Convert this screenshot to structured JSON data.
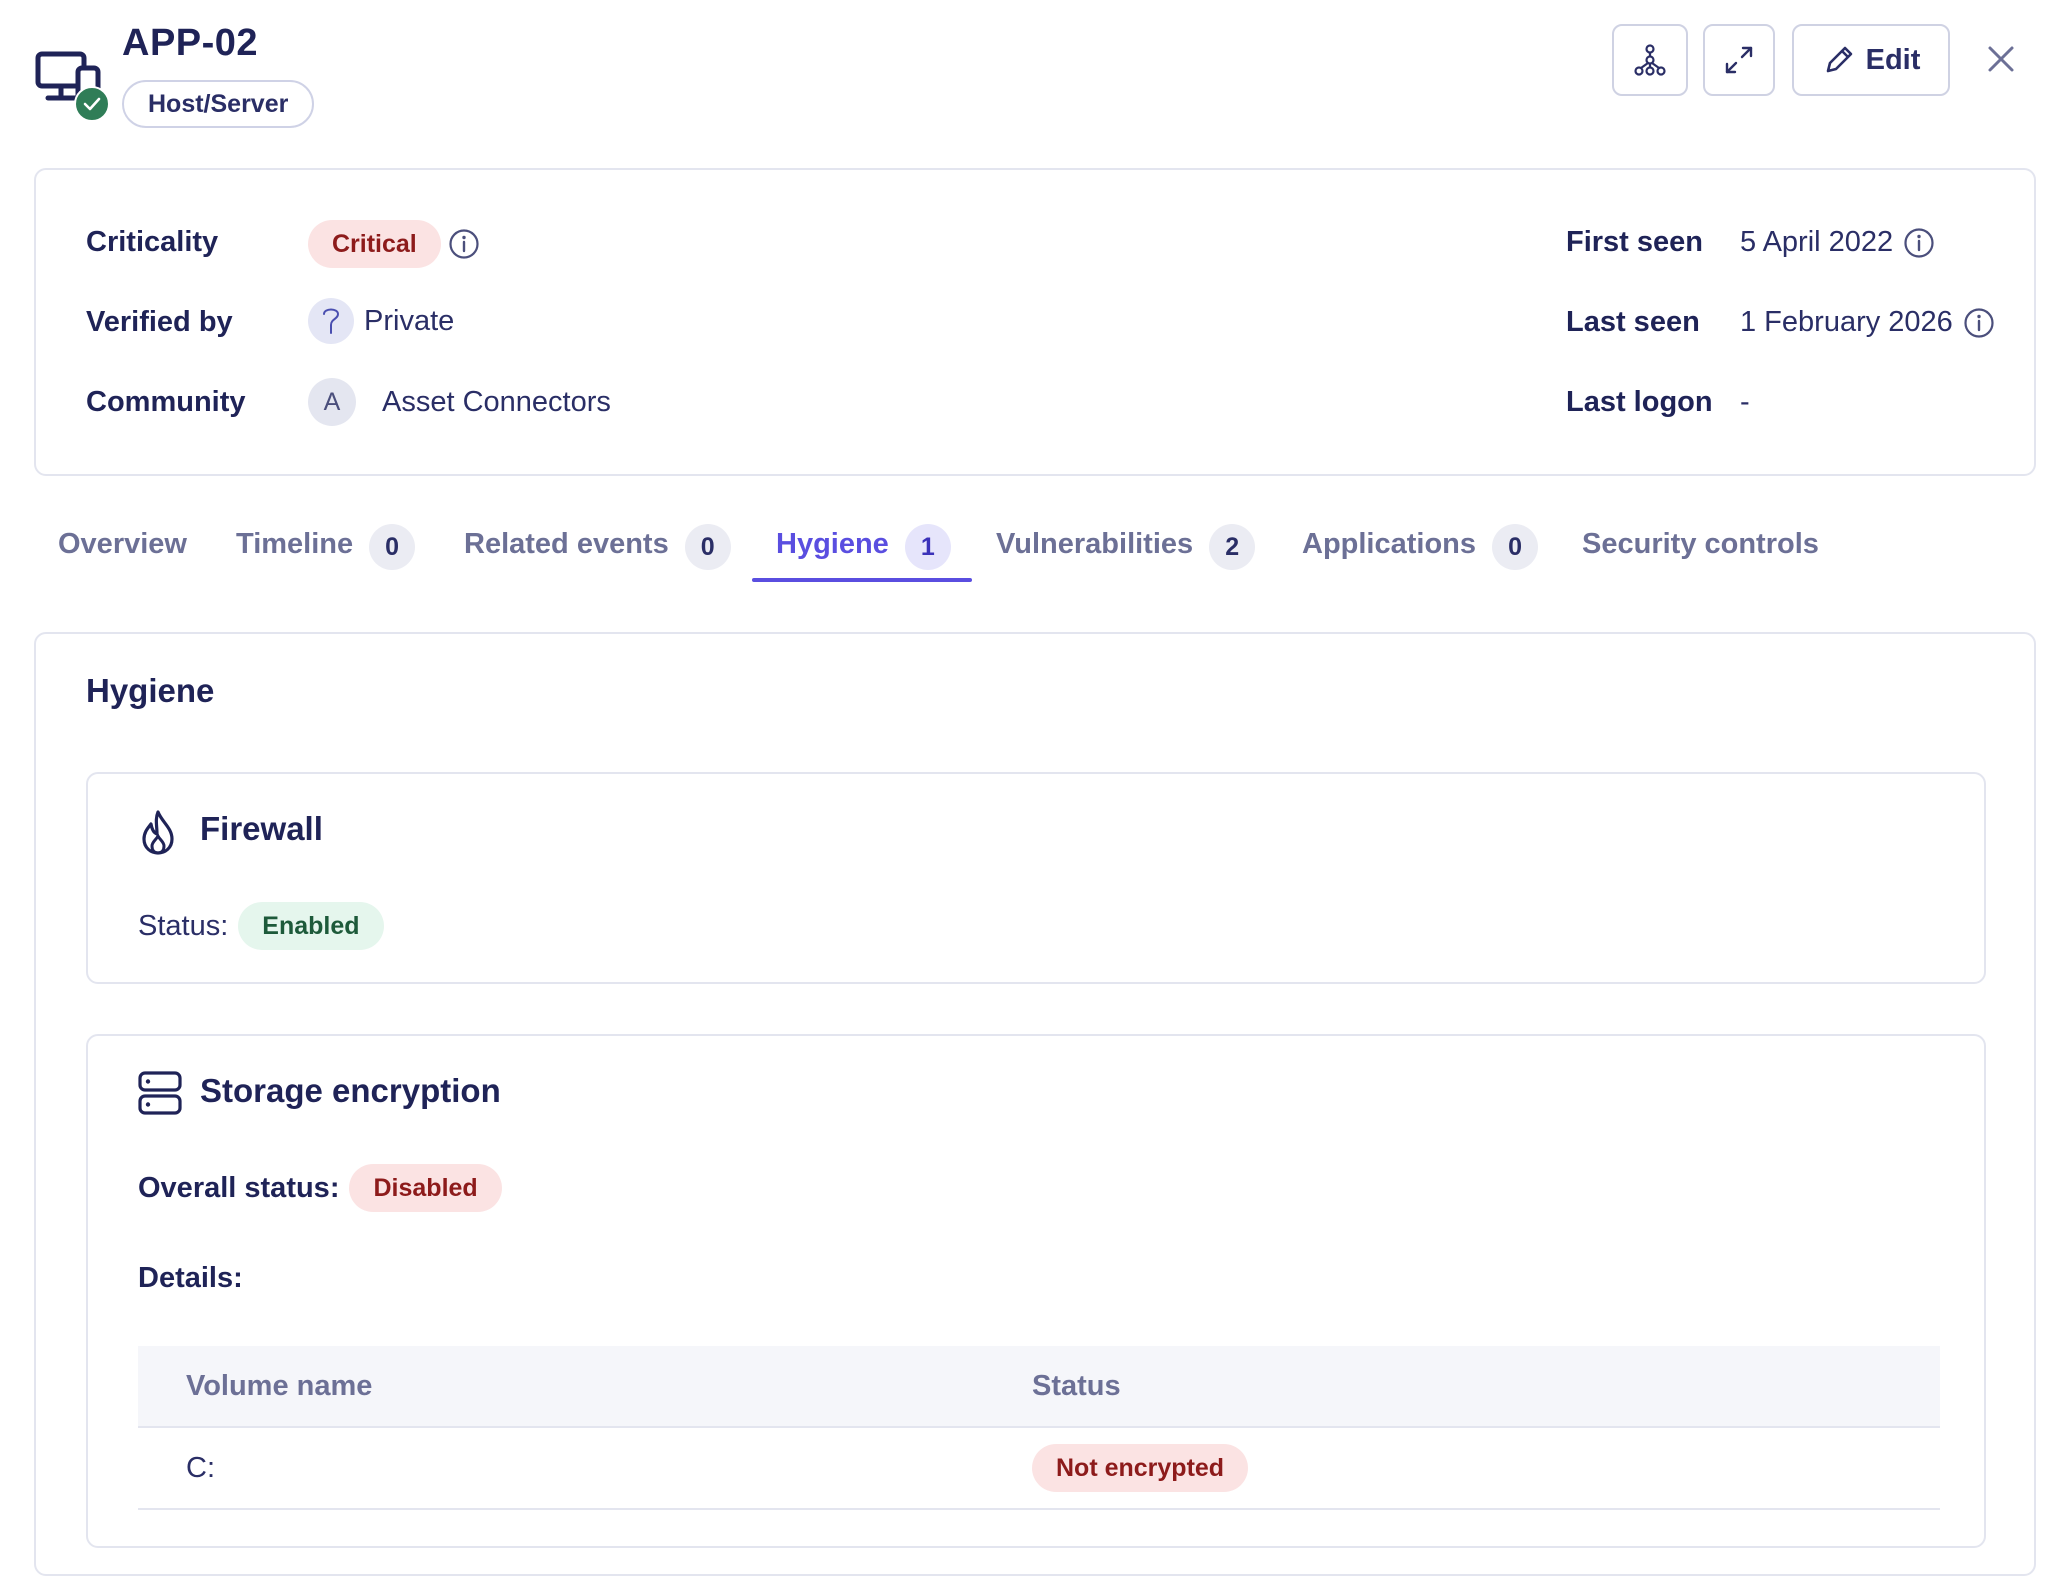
{
  "header": {
    "title": "APP-02",
    "type_badge": "Host/Server",
    "edit_label": "Edit",
    "icons": [
      "device-icon",
      "verified-check-icon",
      "graph-icon",
      "expand-icon",
      "pencil-icon",
      "close-icon"
    ]
  },
  "details": {
    "criticality_label": "Criticality",
    "criticality_value": "Critical",
    "verified_by_label": "Verified by",
    "verified_by_value": "Private",
    "community_label": "Community",
    "community_initial": "A",
    "community_value": "Asset Connectors",
    "first_seen_label": "First seen",
    "first_seen_value": "5 April 2022",
    "last_seen_label": "Last seen",
    "last_seen_value": "1 February 2026",
    "last_logon_label": "Last logon",
    "last_logon_value": "-"
  },
  "tabs": [
    {
      "label": "Overview",
      "count": null
    },
    {
      "label": "Timeline",
      "count": "0"
    },
    {
      "label": "Related events",
      "count": "0"
    },
    {
      "label": "Hygiene",
      "count": "1",
      "active": true
    },
    {
      "label": "Vulnerabilities",
      "count": "2"
    },
    {
      "label": "Applications",
      "count": "0"
    },
    {
      "label": "Security controls",
      "count": null
    }
  ],
  "hygiene": {
    "title": "Hygiene",
    "firewall": {
      "title": "Firewall",
      "status_label": "Status:",
      "status_value": "Enabled"
    },
    "storage": {
      "title": "Storage encryption",
      "overall_label": "Overall status:",
      "overall_value": "Disabled",
      "details_label": "Details:",
      "columns": [
        "Volume name",
        "Status"
      ],
      "rows": [
        {
          "volume": "C:",
          "status": "Not encrypted"
        }
      ]
    }
  },
  "colors": {
    "accent": "#5a4ee0",
    "text_primary": "#1f2357",
    "critical_bg": "#fbe3e3",
    "critical_text": "#8d1b1b",
    "enabled_bg": "#e5f6ed",
    "enabled_text": "#1d5a3a",
    "verified_green": "#2f7d57"
  }
}
